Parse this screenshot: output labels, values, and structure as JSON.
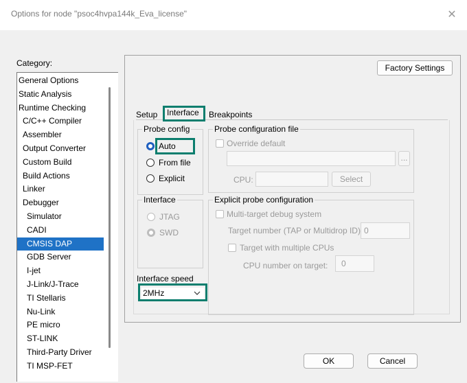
{
  "window": {
    "title": "Options for node \"psoc4hvpa144k_Eva_license\"",
    "close_glyph": "✕"
  },
  "category": {
    "label": "Category:",
    "items": [
      {
        "label": "General Options",
        "indent": 0
      },
      {
        "label": "Static Analysis",
        "indent": 0
      },
      {
        "label": "Runtime Checking",
        "indent": 0
      },
      {
        "label": "C/C++ Compiler",
        "indent": 1
      },
      {
        "label": "Assembler",
        "indent": 1
      },
      {
        "label": "Output Converter",
        "indent": 1
      },
      {
        "label": "Custom Build",
        "indent": 1
      },
      {
        "label": "Build Actions",
        "indent": 1
      },
      {
        "label": "Linker",
        "indent": 1
      },
      {
        "label": "Debugger",
        "indent": 1
      },
      {
        "label": "Simulator",
        "indent": 2
      },
      {
        "label": "CADI",
        "indent": 2
      },
      {
        "label": "CMSIS DAP",
        "indent": 2,
        "selected": true
      },
      {
        "label": "GDB Server",
        "indent": 2
      },
      {
        "label": "I-jet",
        "indent": 2
      },
      {
        "label": "J-Link/J-Trace",
        "indent": 2
      },
      {
        "label": "TI Stellaris",
        "indent": 2
      },
      {
        "label": "Nu-Link",
        "indent": 2
      },
      {
        "label": "PE micro",
        "indent": 2
      },
      {
        "label": "ST-LINK",
        "indent": 2
      },
      {
        "label": "Third-Party Driver",
        "indent": 2
      },
      {
        "label": "TI MSP-FET",
        "indent": 2
      }
    ]
  },
  "factory_settings": "Factory Settings",
  "tabs": [
    "Setup",
    "Interface",
    "Breakpoints"
  ],
  "probe_config": {
    "title": "Probe config",
    "options": [
      "Auto",
      "From file",
      "Explicit"
    ],
    "selected": "Auto"
  },
  "probe_file": {
    "title": "Probe configuration file",
    "override": "Override default",
    "browse": "...",
    "cpu_label": "CPU:",
    "select": "Select"
  },
  "interface": {
    "title": "Interface",
    "options": [
      "JTAG",
      "SWD"
    ],
    "selected": "SWD"
  },
  "explicit": {
    "title": "Explicit probe configuration",
    "multi_target": "Multi-target debug system",
    "target_number_label": "Target number (TAP or Multidrop ID):",
    "target_number_value": "0",
    "multi_cpu": "Target with multiple CPUs",
    "cpu_number_label": "CPU number on target:",
    "cpu_number_value": "0"
  },
  "speed": {
    "label": "Interface speed",
    "value": "2MHz"
  },
  "buttons": {
    "ok": "OK",
    "cancel": "Cancel"
  },
  "colors": {
    "highlight": "#0c7e6e",
    "selection": "#1f72c6",
    "radio_on": "#1f5fbf"
  }
}
